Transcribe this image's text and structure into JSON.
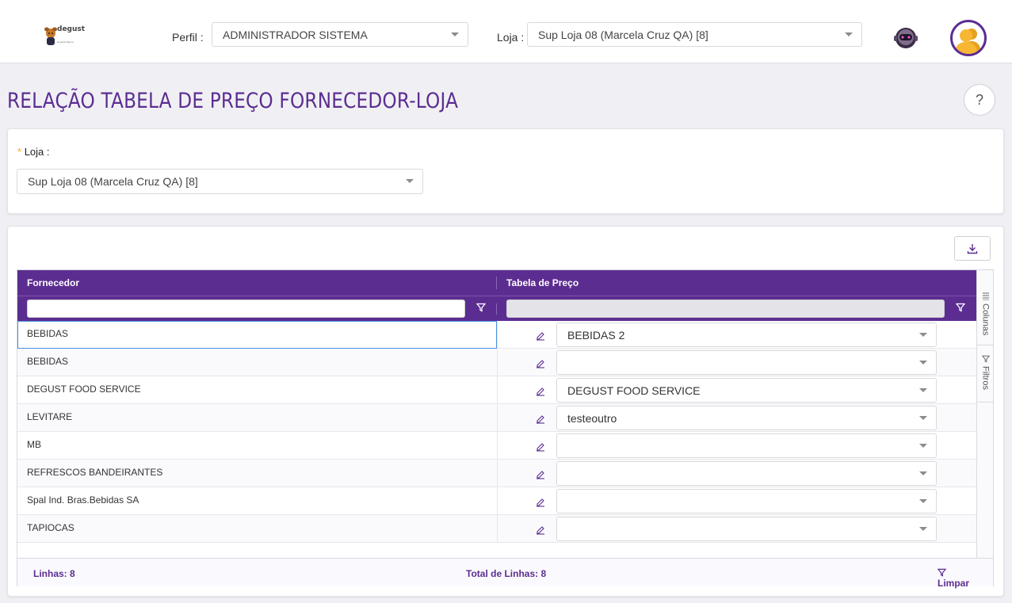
{
  "header": {
    "logo_text": "degust",
    "logo_sub": "Degustti Bigora",
    "perfil_label": "Perfil :",
    "perfil_value": "ADMINISTRADOR SISTEMA",
    "loja_label": "Loja :",
    "loja_value": "Sup Loja 08 (Marcela Cruz QA) [8]"
  },
  "page": {
    "title": "RELAÇÃO TABELA DE PREÇO FORNECEDOR-LOJA",
    "help": "?"
  },
  "form": {
    "required_mark": "*",
    "loja_label": "Loja :",
    "loja_value": "Sup Loja 08 (Marcela Cruz QA) [8]"
  },
  "grid": {
    "columns": [
      "Fornecedor",
      "Tabela de Preço"
    ],
    "side_tabs": [
      "Colunas",
      "Filtros"
    ],
    "rows": [
      {
        "fornecedor": "BEBIDAS",
        "tabela": "BEBIDAS 2"
      },
      {
        "fornecedor": "BEBIDAS",
        "tabela": ""
      },
      {
        "fornecedor": "DEGUST FOOD SERVICE",
        "tabela": "DEGUST FOOD SERVICE"
      },
      {
        "fornecedor": "LEVITARE",
        "tabela": "testeoutro"
      },
      {
        "fornecedor": "MB",
        "tabela": ""
      },
      {
        "fornecedor": "REFRESCOS BANDEIRANTES",
        "tabela": ""
      },
      {
        "fornecedor": "Spal Ind. Bras.Bebidas SA",
        "tabela": ""
      },
      {
        "fornecedor": "TAPIOCAS",
        "tabela": ""
      }
    ],
    "footer": {
      "linhas": "Linhas: 8",
      "total": "Total de Linhas: 8",
      "limpar": "Limpar"
    }
  },
  "colors": {
    "brand": "#5c2d91",
    "required": "#f5a623"
  }
}
